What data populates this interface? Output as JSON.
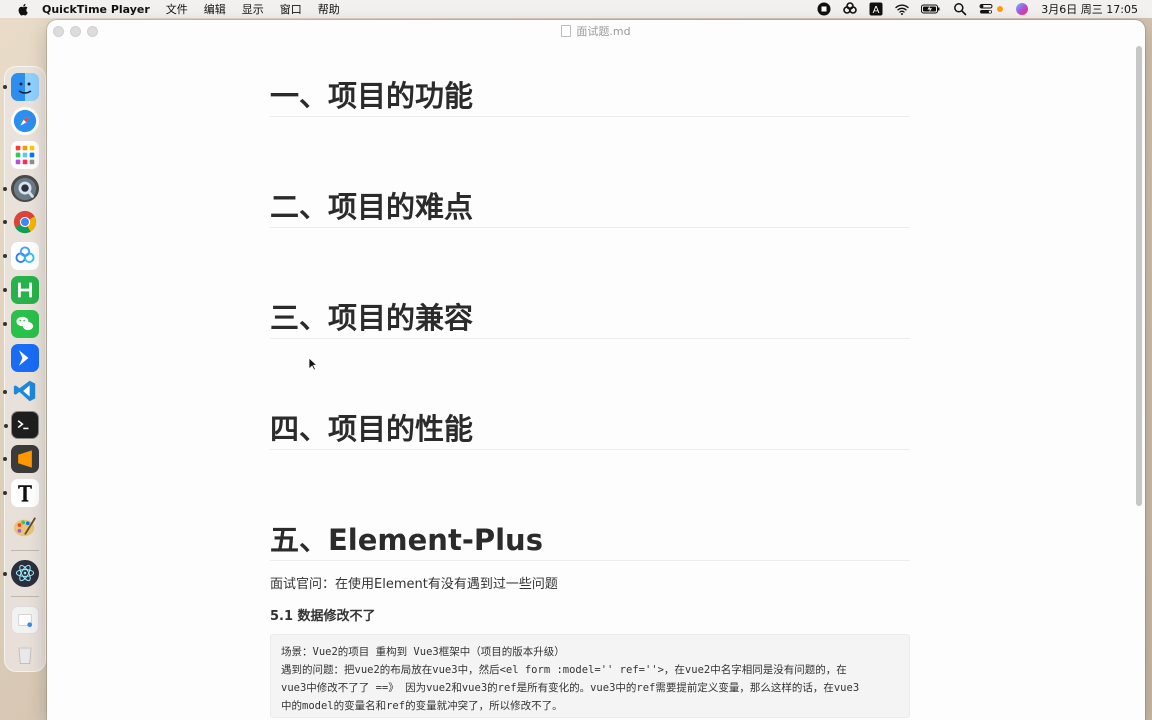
{
  "menubar": {
    "app_name": "QuickTime Player",
    "items": [
      "文件",
      "编辑",
      "显示",
      "窗口",
      "帮助"
    ],
    "clock": "3月6日 周三  17:05"
  },
  "window": {
    "title": "面试题.md"
  },
  "doc": {
    "h1_1": "一、项目的功能",
    "h1_2": "二、项目的难点",
    "h1_3": "三、项目的兼容",
    "h1_4": "四、项目的性能",
    "h1_5": "五、Element-Plus",
    "para_1": "面试官问：在使用Element有没有遇到过一些问题",
    "h4_1": "5.1 数据修改不了",
    "code_lines": [
      "场景：Vue2的项目 重构到 Vue3框架中（项目的版本升级）",
      "遇到的问题：把vue2的布局放在vue3中，然后<el form :model='' ref=''>，在vue2中名字相同是没有问题的，在",
      "vue3中修改不了了 ==》 因为vue2和vue3的ref是所有变化的。vue3中的ref需要提前定义变量，那么这样的话，在vue3",
      "中的model的变量名和ref的变量就冲突了，所以修改不了。"
    ]
  },
  "colors": {
    "heading": "#2b2b2b",
    "text": "#333333",
    "code_bg": "#f4f4f4"
  }
}
